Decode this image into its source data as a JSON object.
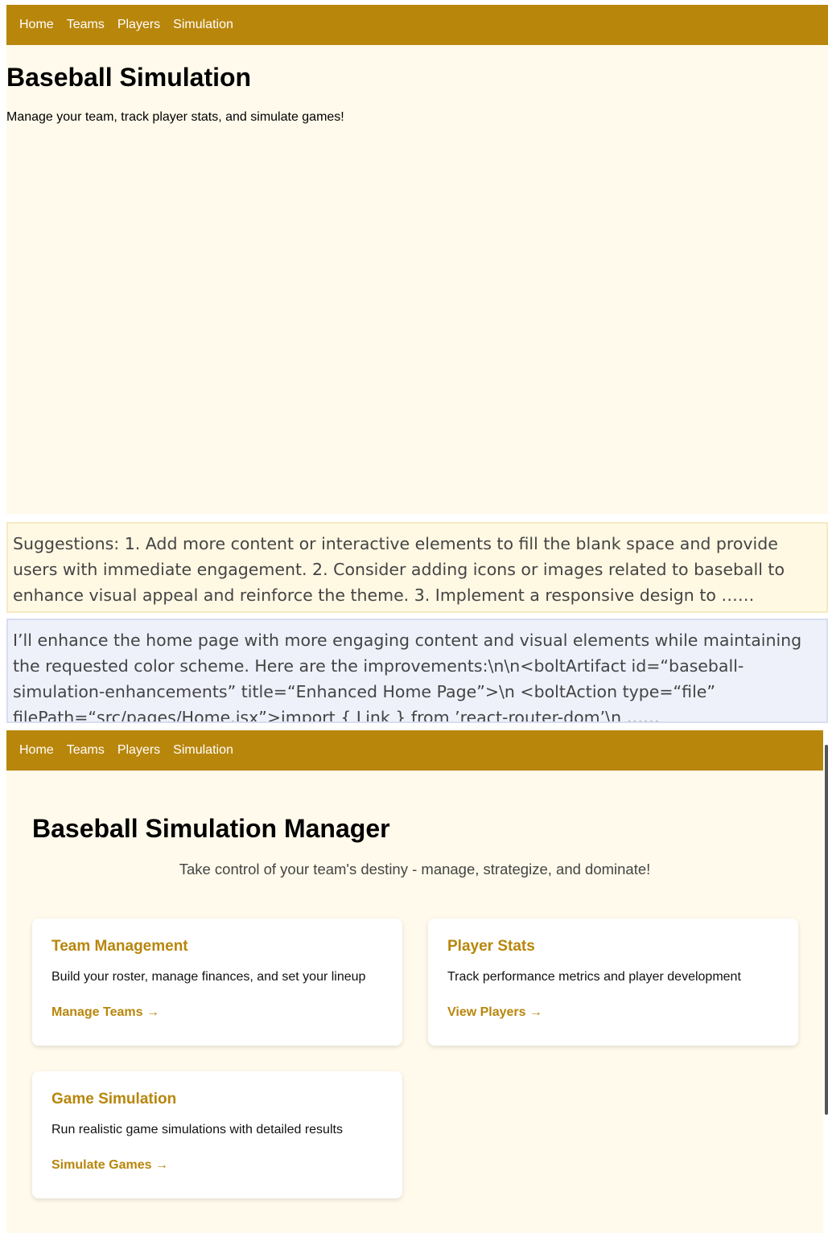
{
  "nav": {
    "items": [
      "Home",
      "Teams",
      "Players",
      "Simulation"
    ]
  },
  "screenshot_before": {
    "title": "Baseball Simulation",
    "subtitle": "Manage your team, track player stats, and simulate games!"
  },
  "suggestions_text": "Suggestions: 1. Add more content or interactive elements to fill the blank space and provide users with immediate engagement. 2. Consider adding icons or images related to baseball to enhance visual appeal and reinforce the theme. 3. Implement a responsive design to ……",
  "response_text": "I’ll enhance the home page with more engaging content and visual elements while maintaining the requested color scheme. Here are the improvements:\\n\\n<boltArtifact id=“baseball-simulation-enhancements” title=“Enhanced Home Page”>\\n  <boltAction type=“file” filePath=“src/pages/Home.jsx”>import { Link } from ’react-router-dom’\\n ……",
  "screenshot_after": {
    "title": "Baseball Simulation Manager",
    "tagline": "Take control of your team's destiny - manage, strategize, and dominate!",
    "cards": [
      {
        "title": "Team Management",
        "desc": "Build your roster, manage finances, and set your lineup",
        "link": "Manage Teams →"
      },
      {
        "title": "Player Stats",
        "desc": "Track performance metrics and player development",
        "link": "View Players →"
      },
      {
        "title": "Game Simulation",
        "desc": "Run realistic game simulations with detailed results",
        "link": "Simulate Games →"
      }
    ]
  },
  "colors": {
    "nav_bg": "#b8860b",
    "page_bg": "#fffaeb",
    "accent": "#b8860b"
  }
}
